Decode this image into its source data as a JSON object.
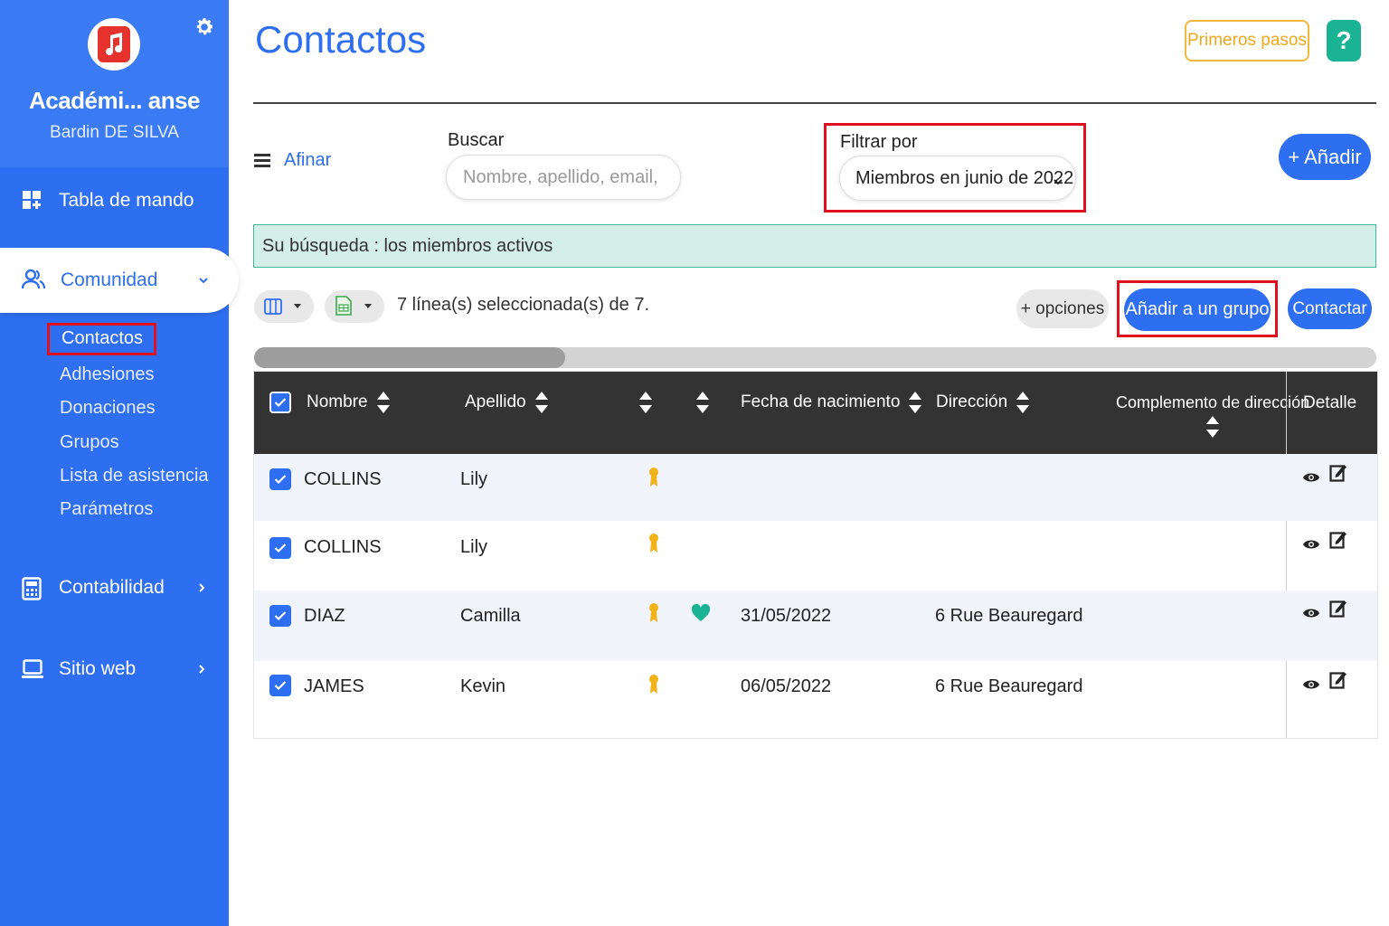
{
  "sidebar": {
    "org_name": "Académi... anse",
    "user_name": "Bardin DE SILVA",
    "nav": {
      "dashboard": "Tabla de mando",
      "community": "Comunidad",
      "accounting": "Contabilidad",
      "website": "Sitio web"
    },
    "community_sub": [
      {
        "label": "Contactos"
      },
      {
        "label": "Adhesiones"
      },
      {
        "label": "Donaciones"
      },
      {
        "label": "Grupos"
      },
      {
        "label": "Lista de asistencia"
      },
      {
        "label": "Parámetros"
      }
    ],
    "colors": {
      "background": "#2e6ef0",
      "active_outline": "#e0111f"
    }
  },
  "header": {
    "title": "Contactos",
    "first_steps": "Primeros pasos",
    "help": "?"
  },
  "filters": {
    "refine": "Afinar",
    "search_label": "Buscar",
    "search_placeholder": "Nombre, apellido, email, ...",
    "filter_label": "Filtrar por",
    "filter_value": "Miembros en junio de 2022",
    "add_button": "+ Añadir"
  },
  "banner": {
    "text": "Su búsqueda : los miembros activos"
  },
  "toolbar": {
    "selection_text": "7 línea(s) seleccionada(s) de 7.",
    "options": "+ opciones",
    "add_to_group": "Añadir a un grupo",
    "contact": "Contactar"
  },
  "table": {
    "columns": {
      "name": "Nombre",
      "surname": "Apellido",
      "birth": "Fecha de nacimiento",
      "address": "Dirección",
      "address2": "Complemento de dirección",
      "detail": "Detalle"
    },
    "rows": [
      {
        "name": "COLLINS",
        "surname": "Lily",
        "member_badge": true,
        "heart": false,
        "birth": "",
        "address": "",
        "checked": true
      },
      {
        "name": "COLLINS",
        "surname": "Lily",
        "member_badge": true,
        "heart": false,
        "birth": "",
        "address": "",
        "checked": true
      },
      {
        "name": "DIAZ",
        "surname": "Camilla",
        "member_badge": true,
        "heart": true,
        "birth": "31/05/2022",
        "address": "6 Rue Beauregard",
        "checked": true
      },
      {
        "name": "JAMES",
        "surname": "Kevin",
        "member_badge": true,
        "heart": false,
        "birth": "06/05/2022",
        "address": "6 Rue Beauregard",
        "checked": true
      }
    ]
  },
  "icons": {
    "gear": "gear-icon",
    "music": "music-note-icon",
    "dashboard": "dashboard-grid-icon",
    "community": "users-icon",
    "accounting": "calculator-icon",
    "website": "monitor-icon",
    "columns": "columns-icon",
    "export": "spreadsheet-export-icon",
    "view": "eye-icon",
    "edit": "edit-icon",
    "badge": "award-ribbon-icon",
    "heart": "heart-icon"
  },
  "accent_colors": {
    "primary": "#2e6ef0",
    "warning": "#f0a81c",
    "success": "#1ab394",
    "badge": "#f2b21a",
    "heart": "#1ab394"
  }
}
